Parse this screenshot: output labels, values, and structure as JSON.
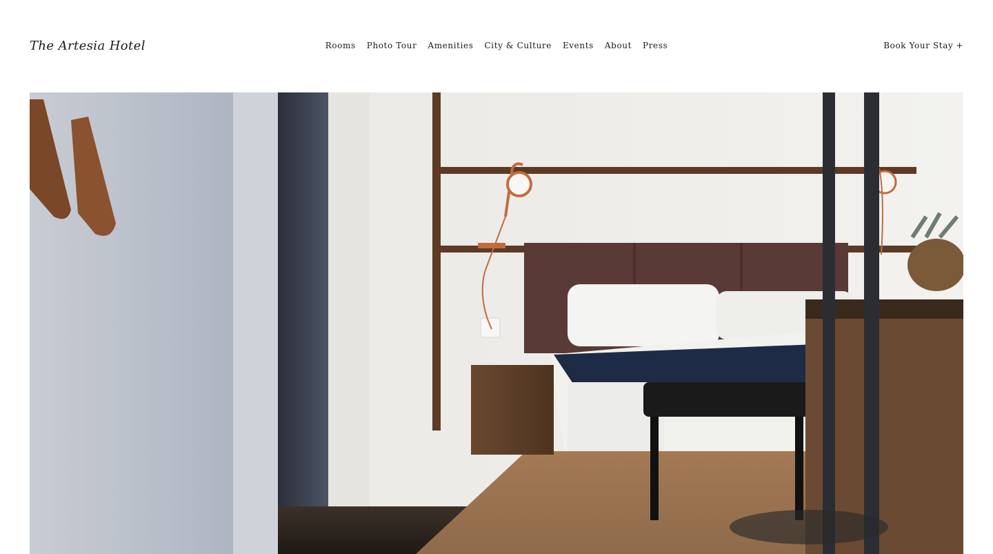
{
  "brand": {
    "name": "The Artesia Hotel"
  },
  "nav": {
    "items": [
      {
        "label": "Rooms"
      },
      {
        "label": "Photo Tour"
      },
      {
        "label": "Amenities"
      },
      {
        "label": "City & Culture"
      },
      {
        "label": "Events"
      },
      {
        "label": "About"
      },
      {
        "label": "Press"
      }
    ]
  },
  "cta": {
    "label": "Book Your Stay",
    "icon": "plus-icon"
  },
  "hero": {
    "alt": "Hotel room with bed, leather headboard and copper lamps"
  },
  "colors": {
    "text": "#1a1a1a",
    "wall": "#f1efeb",
    "leather": "#5a3a36",
    "navy": "#1d2b47",
    "wood": "#5b3b26",
    "copper": "#c06c3f"
  }
}
